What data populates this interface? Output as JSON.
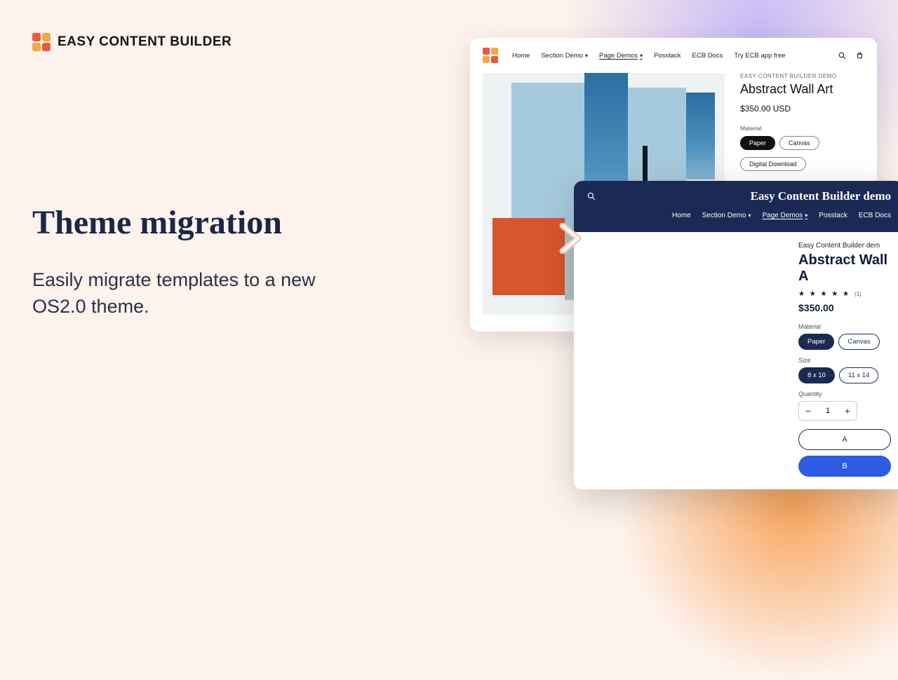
{
  "brand": {
    "name": "EASY CONTENT BUILDER"
  },
  "headline": {
    "title": "Theme migration",
    "subtitle": "Easily migrate templates to a new OS2.0 theme."
  },
  "preview1": {
    "nav": [
      "Home",
      "Section Demo",
      "Page Demos",
      "Posstack",
      "ECB Docs",
      "Try ECB app free"
    ],
    "eyebrow": "EASY CONTENT BUILDER DEMO",
    "title": "Abstract Wall Art",
    "price": "$350.00 USD",
    "material_label": "Material",
    "materials": [
      "Paper",
      "Canvas"
    ],
    "material_selected": "Paper",
    "material_extra": "Digital Download"
  },
  "preview2": {
    "brand": "Easy Content Builder demo",
    "nav": [
      "Home",
      "Section Demo",
      "Page Demos",
      "Posstack",
      "ECB Docs"
    ],
    "eyebrow": "Easy Content Builder dem",
    "title": "Abstract Wall A",
    "rating": "★ ★ ★ ★ ★",
    "rating_count": "(1)",
    "price": "$350.00",
    "material_label": "Material",
    "materials": [
      "Paper",
      "Canvas"
    ],
    "material_selected": "Paper",
    "size_label": "Size",
    "sizes": [
      "8 x 10",
      "11 x 14"
    ],
    "size_selected": "8 x 10",
    "quantity_label": "Quantity",
    "quantity_value": "1",
    "add_label": "A",
    "buy_label": "B"
  }
}
